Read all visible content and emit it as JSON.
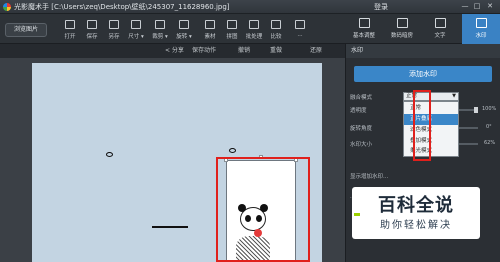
{
  "titlebar": {
    "title": "光影魔术手 [C:\\Users\\zeq\\Desktop\\壁纸\\245307_11628960.jpg]",
    "login": "登录",
    "minimize": "—",
    "maximize": "□",
    "close": "✕"
  },
  "toolbar": {
    "browse": "浏览图片",
    "items": [
      {
        "label": "打开",
        "icon": "open-icon"
      },
      {
        "label": "保存",
        "icon": "save-icon"
      },
      {
        "label": "另存",
        "icon": "save-as-icon"
      },
      {
        "label": "尺寸 ▾",
        "icon": "resize-icon"
      },
      {
        "label": "裁剪 ▾",
        "icon": "crop-icon"
      },
      {
        "label": "旋转 ▾",
        "icon": "rotate-icon"
      },
      {
        "label": "素材",
        "icon": "material-icon"
      },
      {
        "label": "拼图",
        "icon": "collage-icon"
      },
      {
        "label": "批处理",
        "icon": "batch-icon"
      },
      {
        "label": "比较",
        "icon": "compare-icon"
      },
      {
        "label": "...",
        "icon": "more-icon"
      }
    ]
  },
  "tabs": [
    {
      "label": "基本调整",
      "icon": "adjust-icon",
      "active": false
    },
    {
      "label": "数码暗房",
      "icon": "darkroom-icon",
      "active": false
    },
    {
      "label": "文字",
      "icon": "text-icon",
      "active": false
    },
    {
      "label": "水印",
      "icon": "watermark-icon",
      "active": true
    }
  ],
  "subbar": {
    "share": "< 分享",
    "save_action": "保存动作",
    "undo": "撤销",
    "redo": "重做",
    "restore": "还原"
  },
  "panel": {
    "header": "水印",
    "add_button": "添加水印",
    "blend_label": "融合模式",
    "blend_value": "正常",
    "blend_options": [
      "正常",
      "正片叠底",
      "滤色模式",
      "叠加模式",
      "柔光模式"
    ],
    "blend_selected": 1,
    "opacity_label": "透明度",
    "opacity_value": "100%",
    "rotate_label": "旋转角度",
    "rotate_value": "0°",
    "size_label": "水印大小",
    "size_value": "62%",
    "bottom_opt1": "显示增加水印...",
    "bottom_opt2": "..."
  },
  "overlay": {
    "big": "百科全说",
    "small": "助你轻松解决"
  },
  "colors": {
    "accent": "#3a86c8",
    "highlight": "#e0201c",
    "canvas_bg": "#c3d4e2"
  }
}
